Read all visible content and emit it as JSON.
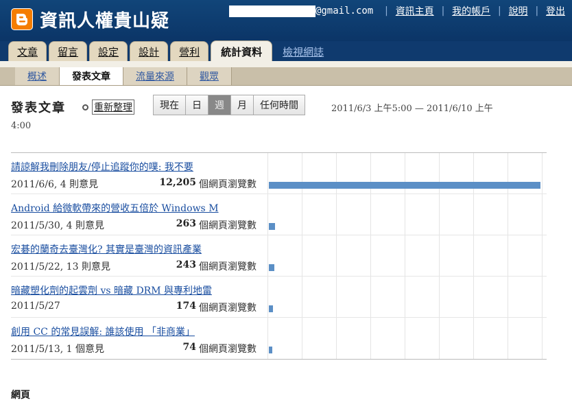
{
  "header": {
    "blog_title": "資訊人權貴山疑",
    "email_suffix": "@gmail.com",
    "links": [
      "資訊主頁",
      "我的帳戶",
      "說明",
      "登出"
    ]
  },
  "tabs": [
    "文章",
    "留言",
    "設定",
    "設計",
    "營利",
    "統計資料"
  ],
  "view_blog_link": "檢視網誌",
  "subtabs": [
    "概述",
    "發表文章",
    "流量來源",
    "觀眾"
  ],
  "page": {
    "title": "發表文章",
    "refresh_label": "重新整理",
    "range_buttons": [
      "現在",
      "日",
      "週",
      "月",
      "任何時間"
    ],
    "active_range": "週",
    "date_range_line1": "2011/6/3 上午5:00 — 2011/6/10 上午",
    "date_range_line2": "4:00"
  },
  "posts": [
    {
      "title": "請諒解我刪除朋友/停止追蹤你的噗: 我不要",
      "meta": "2011/6/6, 4 則意見",
      "count": "12,205",
      "unit": "個網頁瀏覽數",
      "views": 12205
    },
    {
      "title": "Android 給微軟帶來的營收五倍於 Windows M",
      "meta": "2011/5/30, 4 則意見",
      "count": "263",
      "unit": "個網頁瀏覽數",
      "views": 263
    },
    {
      "title": "宏碁的蘭奇去臺灣化? 其實是臺灣的資訊產業",
      "meta": "2011/5/22, 13 則意見",
      "count": "243",
      "unit": "個網頁瀏覽數",
      "views": 243
    },
    {
      "title": "暗藏塑化劑的起雲劑 vs 暗藏 DRM 與專利地雷",
      "meta": "2011/5/27",
      "count": "174",
      "unit": "個網頁瀏覽數",
      "views": 174
    },
    {
      "title": "創用 CC 的常見誤解: 誰該使用 「非商業」",
      "meta": "2011/5/13, 1 個意見",
      "count": "74",
      "unit": "個網頁瀏覽數",
      "views": 74
    }
  ],
  "max_views": 12205,
  "section_heading": "網頁"
}
